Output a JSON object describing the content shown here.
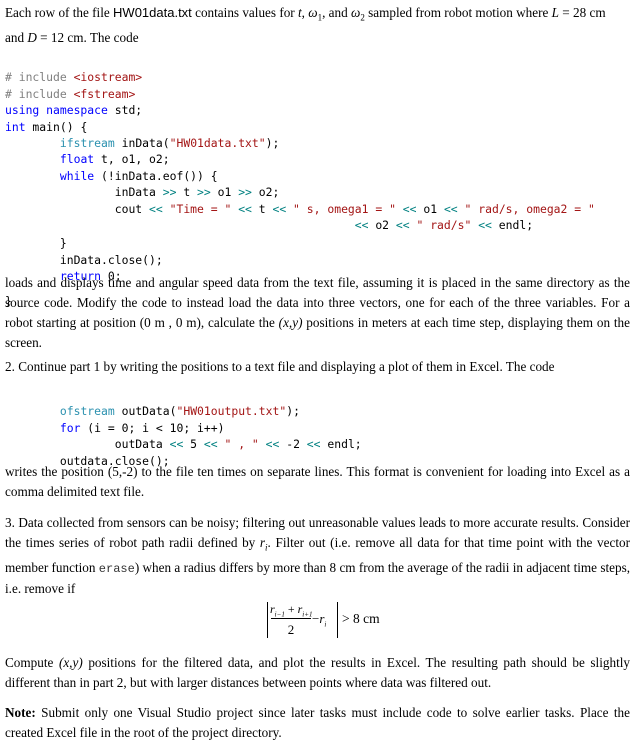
{
  "intro": {
    "line1_a": "Each row of the file ",
    "filename": "HW01data.txt",
    "line1_b": " contains values for ",
    "var_t": "t",
    "sep1": ", ",
    "var_w1": "ω",
    "sub1": "1",
    "sep2": ", and ",
    "var_w2": "ω",
    "sub2": "2",
    "line1_c": " sampled from robot motion where ",
    "var_L": "L",
    "L_val": " = 28 cm",
    "line2_a": "and ",
    "var_D": "D",
    "D_val": " = 12 cm. The code"
  },
  "code1": {
    "l1_pp": "# include ",
    "l1_str": "<iostream>",
    "l2_pp": "# include ",
    "l2_str": "<fstream>",
    "l3_kw": "using namespace",
    "l3_rest": " std;",
    "l4_kw": "int",
    "l4_rest": " main() {",
    "l5_indent": "        ",
    "l5_typ": "ifstream",
    "l5_a": " inData(",
    "l5_str": "\"HW01data.txt\"",
    "l5_b": ");",
    "l6_indent": "        ",
    "l6_kw": "float",
    "l6_rest": " t, o1, o2;",
    "l7_indent": "        ",
    "l7_kw": "while",
    "l7_rest": " (!inData.eof()) {",
    "l8_indent": "                ",
    "l8_a": "inData ",
    "l8_op1": ">>",
    "l8_b": " t ",
    "l8_op2": ">>",
    "l8_c": " o1 ",
    "l8_op3": ">>",
    "l8_d": " o2;",
    "l9_indent": "                ",
    "l9_a": "cout ",
    "l9_op1": "<<",
    "l9_s1": " \"Time = \" ",
    "l9_op2": "<<",
    "l9_b": " t ",
    "l9_op3": "<<",
    "l9_s2": " \" s, omega1 = \" ",
    "l9_op4": "<<",
    "l9_c": " o1 ",
    "l9_op5": "<<",
    "l9_s3": " \" rad/s, omega2 = \"",
    "l10_indent": "                                                   ",
    "l10_op1": "<<",
    "l10_a": " o2 ",
    "l10_op2": "<<",
    "l10_s1": " \" rad/s\" ",
    "l10_op3": "<<",
    "l10_b": " endl;",
    "l11": "        }",
    "l12": "        inData.close();",
    "l13_indent": "        ",
    "l13_kw": "return",
    "l13_rest": " 0;",
    "l14": "}"
  },
  "part1_text": "loads and displays time and angular speed data from the text file, assuming it is placed in the same directory as the source code. Modify the code to instead load the data into three vectors, one for each of the three variables. For a robot starting at position (0 m , 0 m), calculate the ",
  "part1_xy": "(x,y)",
  "part1_tail": " positions in meters at each time step, displaying them on the screen.",
  "part2_text": "2. Continue part 1 by writing the positions to a text file and displaying a plot of them in Excel. The code",
  "code2": {
    "l1_indent": "        ",
    "l1_typ": "ofstream",
    "l1_a": " outData(",
    "l1_str": "\"HW01output.txt\"",
    "l1_b": ");",
    "l2_indent": "        ",
    "l2_kw": "for",
    "l2_rest": " (i = 0; i < 10; i++)",
    "l3_indent": "                ",
    "l3_a": "outData ",
    "l3_op1": "<<",
    "l3_b": " 5 ",
    "l3_op2": "<<",
    "l3_s1": " \" , \" ",
    "l3_op3": "<<",
    "l3_c": " -2 ",
    "l3_op4": "<<",
    "l3_d": " endl;",
    "l4": "        outdata.close();"
  },
  "part2_after": "writes the position (5,-2) to the file ten times on separate lines. This format is convenient for loading into Excel as a comma delimited text file.",
  "part3": {
    "a": "3. Data collected from sensors can be noisy; filtering out unreasonable values leads to more accurate results. Consider the times series of robot path radii defined by ",
    "r": "r",
    "r_sub": "i",
    "b": ". Filter out (i.e. remove all data for that time point with the vector member function ",
    "erase": "erase",
    "c": ") when a radius differs by more than 8 cm from the average of the radii in adjacent time steps, i.e. remove if"
  },
  "formula": {
    "num_r1": "r",
    "num_sub1": "i−1",
    "plus": " + ",
    "num_r2": "r",
    "num_sub2": "i+1",
    "den": "2",
    "minus": "−",
    "ri": "r",
    "ri_sub": "i",
    "rhs": "> 8 cm"
  },
  "compute_a": "Compute ",
  "compute_xy": "(x,y)",
  "compute_b": " positions for the filtered data, and plot the results in Excel. The resulting path should be slightly different than in part 2, but with larger distances between points where data was filtered out.",
  "note": {
    "label": "Note:",
    "text": " Submit only one Visual Studio project since later tasks must include code to solve earlier tasks. Place the created Excel file in the root of the project directory."
  }
}
